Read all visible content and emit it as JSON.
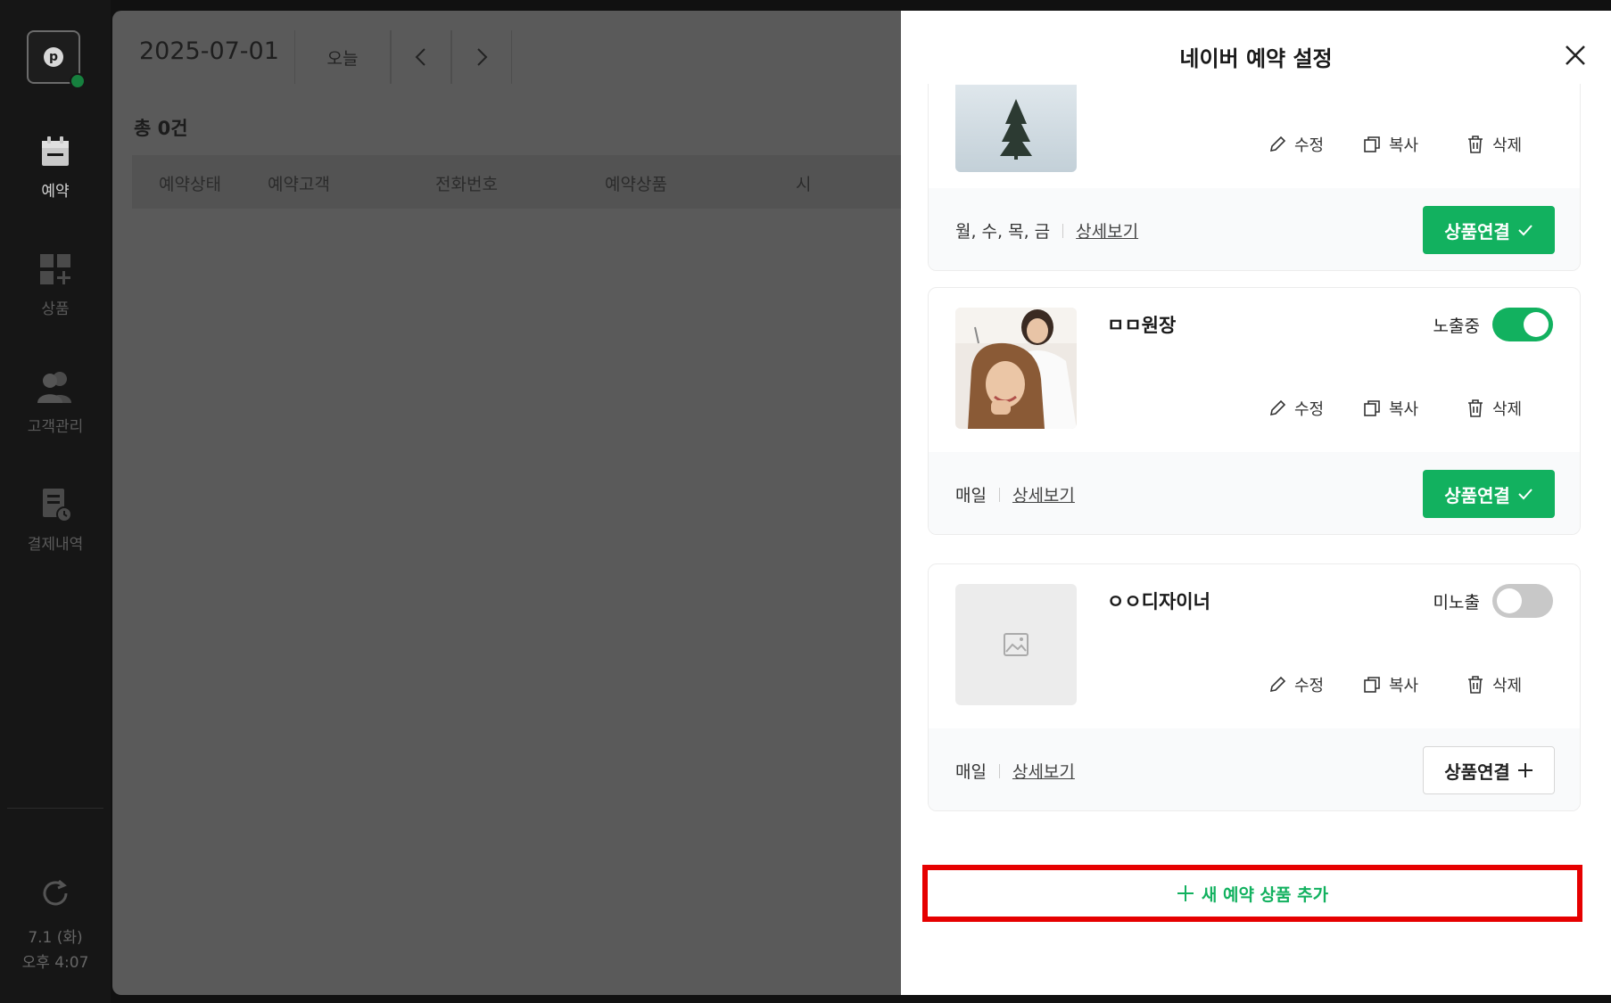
{
  "sidebar": {
    "logo_letter": "p",
    "items": [
      {
        "label": "예약",
        "icon": "calendar-icon",
        "active": true
      },
      {
        "label": "상품",
        "icon": "grid-plus-icon",
        "active": false
      },
      {
        "label": "고객관리",
        "icon": "users-icon",
        "active": false
      },
      {
        "label": "결제내역",
        "icon": "receipt-clock-icon",
        "active": false
      }
    ],
    "date": "7.1 (화)",
    "time": "오후 4:07"
  },
  "main": {
    "date": "2025-07-01",
    "today_label": "오늘",
    "total": "총 0건",
    "columns": [
      "예약상태",
      "예약고객",
      "전화번호",
      "예약상품",
      "시"
    ]
  },
  "panel": {
    "title": "네이버 예약 설정",
    "actions": {
      "edit": "수정",
      "copy": "복사",
      "delete": "삭제"
    },
    "detail_label": "상세보기",
    "cards": [
      {
        "name": "",
        "days": "월, 수, 목, 금",
        "link_label": "상품연결",
        "linked": true
      },
      {
        "name": "ㅁㅁ원장",
        "status": "노출중",
        "toggle_on": true,
        "days": "매일",
        "link_label": "상품연결",
        "linked": true
      },
      {
        "name": "ㅇㅇ디자이너",
        "status": "미노출",
        "toggle_on": false,
        "days": "매일",
        "link_label": "상품연결",
        "linked": false
      }
    ],
    "add_label": "새 예약 상품 추가"
  },
  "colors": {
    "accent_green": "#12b15f",
    "highlight_red": "#e60000"
  }
}
